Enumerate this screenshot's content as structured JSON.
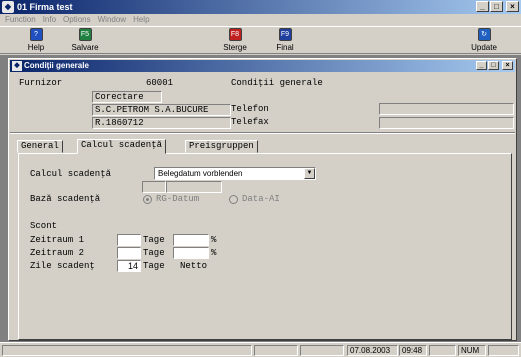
{
  "app": {
    "title": "01  Firma test"
  },
  "menu": [
    "Function",
    "Info",
    "Options",
    "Window",
    "Help"
  ],
  "toolbar": [
    {
      "label": "Help",
      "icon": "help-icon",
      "color": "#2050c0"
    },
    {
      "label": "Salvare",
      "icon": "save-icon",
      "color": "#208040"
    },
    {
      "label": "Sterge",
      "icon": "delete-icon",
      "color": "#c02020"
    },
    {
      "label": "Final",
      "icon": "final-icon",
      "color": "#2040a0"
    },
    {
      "label": "Update",
      "icon": "update-icon",
      "color": "#2060c0"
    }
  ],
  "child": {
    "title": "Condiţii generale",
    "furnizor_label": "Furnizor",
    "furnizor_id": "60001",
    "section_title": "Condiţii generale",
    "supplier_name": "Corectare",
    "supplier_company": "S.C.PETROM S.A.BUCURE",
    "supplier_reg": "R.1860712",
    "telefon_label": "Telefon",
    "telefax_label": "Telefax",
    "telefon_value": "",
    "telefax_value": ""
  },
  "tabs": [
    "General",
    "Calcul scadenţă",
    "Preisgruppen"
  ],
  "active_tab": 1,
  "panel": {
    "calcul_label": "Calcul scadenţă",
    "calcul_value": "Belegdatum vorblenden",
    "baza_label": "Bază scadenţă",
    "radio_1": "RG-Datum",
    "radio_2": "Data-AI",
    "scont_label": "Scont",
    "zeitraum1_label": "Zeitraum 1",
    "zeitraum2_label": "Zeitraum 2",
    "zile_label": "Zile scadenţ",
    "tage": "Tage",
    "percent": "%",
    "zile_value": "14",
    "netto": "Netto"
  },
  "status": {
    "date": "07.08.2003",
    "time": "09:48",
    "num": "NUM"
  }
}
